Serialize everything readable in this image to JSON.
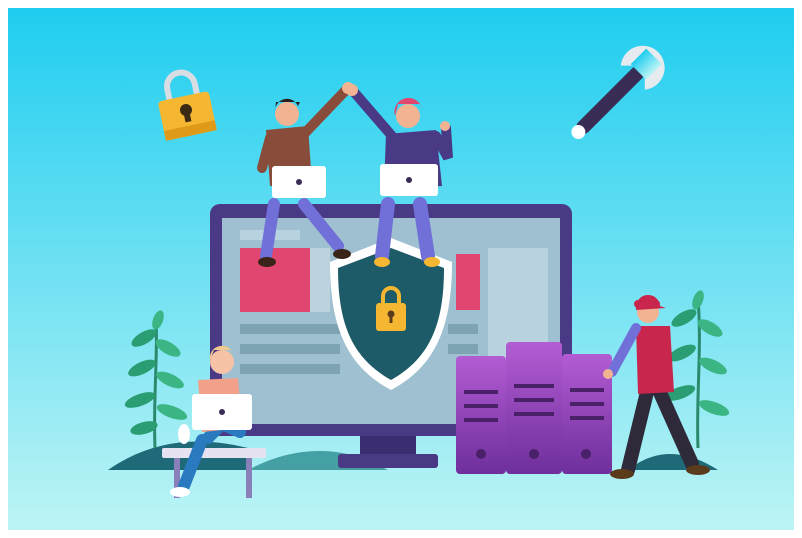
{
  "illustration": {
    "colors": {
      "sky_top": "#1fcdf0",
      "sky_bottom": "#b8f3f5",
      "monitor_frame": "#4a3a86",
      "monitor_screen": "#9fc0d0",
      "shield_fill": "#1e5b68",
      "lock_gold": "#f5b731",
      "server_purple": "#8a3bb5",
      "accent_red": "#e04670"
    },
    "icons": [
      "padlock-icon",
      "wrench-icon",
      "shield-icon",
      "server-icon",
      "laptop-icon",
      "plant-icon"
    ]
  }
}
